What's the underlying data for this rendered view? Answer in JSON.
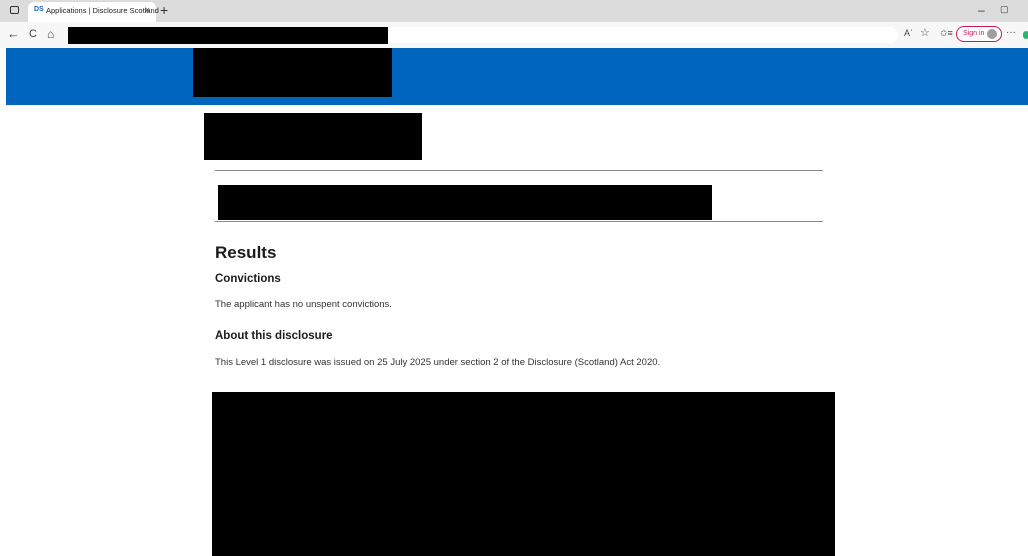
{
  "browser": {
    "tab": {
      "favicon_text": "DS",
      "title": "Applications | Disclosure Scotland",
      "close_glyph": "×"
    },
    "new_tab_glyph": "+",
    "window_controls": {
      "minimize_glyph": "–",
      "restore_glyph": "▢"
    },
    "nav": {
      "back_glyph": "←",
      "refresh_glyph": "C",
      "home_glyph": "⌂"
    },
    "toolbar": {
      "read_aloud_glyph": "Aʾ",
      "favorite_glyph": "☆",
      "favorites_glyph": "✩≡",
      "sign_in_label": "Sign in",
      "more_glyph": "···"
    },
    "icons": [
      "tab-actions-icon",
      "back-arrow-icon",
      "refresh-icon",
      "home-icon",
      "read-aloud-icon",
      "star-icon",
      "favorites-icon",
      "profile-avatar-icon",
      "more-menu-icon"
    ]
  },
  "colors": {
    "header_blue": "#0065bd",
    "redaction": "#000000",
    "sign_in_accent": "#c2185b"
  },
  "main": {
    "results_heading": "Results",
    "convictions_heading": "Convictions",
    "convictions_text": "The applicant has no unspent convictions.",
    "about_heading": "About this disclosure",
    "about_text": "This Level 1 disclosure was issued on 25 July 2025 under section 2 of the Disclosure (Scotland) Act 2020."
  }
}
